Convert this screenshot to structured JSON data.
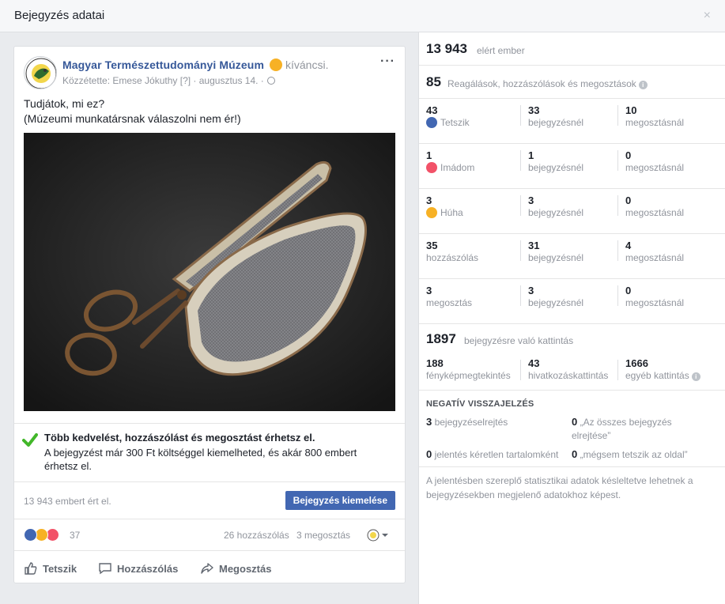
{
  "dialog": {
    "title": "Bejegyzés adatai",
    "close_label": "×"
  },
  "post": {
    "page_name": "Magyar Természettudományi Múzeum",
    "feeling": "kíváncsi.",
    "published_by": "Közzétette: Emese Jókuthy [?] · augusztus 14. ·",
    "more_label": "···",
    "text_line1": "Tudjátok, mi ez?",
    "text_line2": "(Múzeumi munkatársnak válaszolni nem ér!)",
    "promo_title": "Több kedvelést, hozzászólást és megosztást érhetsz el.",
    "promo_body": "A bejegyzést már 300 Ft költséggel kiemelheted, és akár 800 embert érhetsz el.",
    "reach_text": "13 943 embert ért el.",
    "boost_label": "Bejegyzés kiemelése",
    "reaction_count": "37",
    "comments_count": "26 hozzászólás",
    "shares_count": "3 megosztás",
    "actions": {
      "like": "Tetszik",
      "comment": "Hozzászólás",
      "share": "Megosztás"
    }
  },
  "stats": {
    "reached_number": "13 943",
    "reached_label": "elért ember",
    "engagement_number": "85",
    "engagement_label": "Reagálások, hozzászólások és megosztások",
    "rows": [
      {
        "total": "43",
        "label": "Tetszik",
        "icon": "like-icon",
        "on_post": "33",
        "on_post_label": "bejegyzésnél",
        "on_shares": "10",
        "on_shares_label": "megosztásnál"
      },
      {
        "total": "1",
        "label": "Imádom",
        "icon": "love-icon",
        "on_post": "1",
        "on_post_label": "bejegyzésnél",
        "on_shares": "0",
        "on_shares_label": "megosztásnál"
      },
      {
        "total": "3",
        "label": "Húha",
        "icon": "wow-icon",
        "on_post": "3",
        "on_post_label": "bejegyzésnél",
        "on_shares": "0",
        "on_shares_label": "megosztásnál"
      },
      {
        "total": "35",
        "label": "hozzászólás",
        "icon": "",
        "on_post": "31",
        "on_post_label": "bejegyzésnél",
        "on_shares": "4",
        "on_shares_label": "megosztásnál"
      },
      {
        "total": "3",
        "label": "megosztás",
        "icon": "",
        "on_post": "3",
        "on_post_label": "bejegyzésnél",
        "on_shares": "0",
        "on_shares_label": "megosztásnál"
      }
    ],
    "clicks_number": "1897",
    "clicks_label": "bejegyzésre való kattintás",
    "photo_views": "188",
    "photo_views_label": "fényképmegtekintés",
    "link_clicks": "43",
    "link_clicks_label": "hivatkozáskattintás",
    "other_clicks": "1666",
    "other_clicks_label": "egyéb kattintás",
    "negative_title": "NEGATÍV VISSZAJELZÉS",
    "hide_post_n": "3",
    "hide_post_label": "bejegyzéselrejtés",
    "hide_all_n": "0",
    "hide_all_label": "„Az összes bejegyzés elrejtése”",
    "spam_n": "0",
    "spam_label": "jelentés kéretlen tartalomként",
    "unlike_n": "0",
    "unlike_label": "„mégsem tetszik az oldal”",
    "footnote": "A jelentésben szereplő statisztikai adatok késleltetve lehetnek a bejegyzésekben megjelenő adatokhoz képest."
  },
  "colors": {
    "brand": "#4267b2",
    "link": "#365899",
    "like": "#4267b2",
    "love": "#f25268",
    "wow": "#f7b125",
    "check": "#42b72a"
  }
}
